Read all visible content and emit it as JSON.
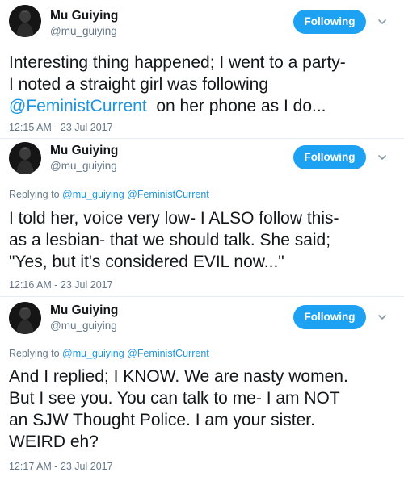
{
  "colors": {
    "accent": "#1da1f2",
    "link": "#1b95e0",
    "secondary_text": "#657786",
    "primary_text": "#14171a"
  },
  "tweets": [
    {
      "display_name": "Mu Guiying",
      "handle": "@mu_guiying",
      "follow_label": "Following",
      "menu_icon": "chevron-down-icon",
      "body_line_1": "Interesting thing happened; I went to a party-",
      "body_line_2": "I noted a straight girl was following",
      "body_line_3_mention": "@FeministCurrent",
      "body_line_3_rest": "on her phone as I do...",
      "timestamp": "12:15 AM - 23 Jul 2017"
    },
    {
      "display_name": "Mu Guiying",
      "handle": "@mu_guiying",
      "follow_label": "Following",
      "menu_icon": "chevron-down-icon",
      "replying_prefix": "Replying to",
      "replying_user_1": "@mu_guiying",
      "replying_user_2": "@FeministCurrent",
      "body_line_1": "I told her, voice very low- I ALSO follow this-",
      "body_line_2": "as a lesbian- that we should talk. She said;",
      "body_line_3": "\"Yes, but it's considered EVIL now...\"",
      "timestamp": "12:16 AM - 23 Jul 2017"
    },
    {
      "display_name": "Mu Guiying",
      "handle": "@mu_guiying",
      "follow_label": "Following",
      "menu_icon": "chevron-down-icon",
      "replying_prefix": "Replying to",
      "replying_user_1": "@mu_guiying",
      "replying_user_2": "@FeministCurrent",
      "body_line_1": "And I replied; I KNOW. We are nasty women.",
      "body_line_2": "But I see you. You can talk to me- I am NOT",
      "body_line_3": "an SJW Thought Police. I am your sister.",
      "body_line_4": "WEIRD eh?",
      "timestamp": "12:17 AM - 23 Jul 2017"
    }
  ]
}
